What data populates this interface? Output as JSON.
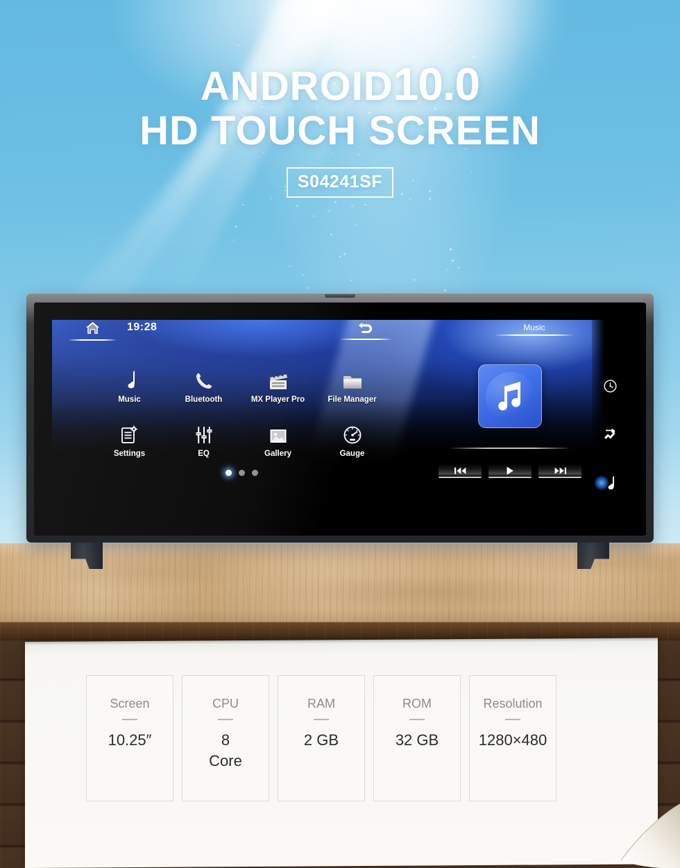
{
  "hero": {
    "line1_main": "ANDROID",
    "line1_version": "10.0",
    "line2": "HD TOUCH SCREEN",
    "model_badge": "S04241SF"
  },
  "colors": {
    "sky": "#63b9e2",
    "accent_blue": "#3f6fe8",
    "panel_bg": "#faf9f6",
    "wood_light": "#d9bb8e",
    "wood_dark": "#3d2a1b"
  },
  "device_screen": {
    "status_bar": {
      "home_icon": "home-icon",
      "clock": "19:28",
      "back_icon": "back-arrow-icon",
      "music_tab_label": "Music"
    },
    "apps": [
      {
        "label": "Music",
        "icon": "music-note-icon"
      },
      {
        "label": "Bluetooth",
        "icon": "phone-handset-icon"
      },
      {
        "label": "MX Player Pro",
        "icon": "clapperboard-icon"
      },
      {
        "label": "File Manager",
        "icon": "folder-icon"
      },
      {
        "label": "Settings",
        "icon": "settings-list-gear-icon"
      },
      {
        "label": "EQ",
        "icon": "equalizer-sliders-icon"
      },
      {
        "label": "Gallery",
        "icon": "photo-image-icon"
      },
      {
        "label": "Gauge",
        "icon": "speedometer-icon"
      }
    ],
    "page_dots": {
      "total": 3,
      "active_index": 0
    },
    "music_widget": {
      "title": "Music",
      "album_art_icon": "music-note-icon",
      "controls": [
        {
          "name": "previous",
          "icon": "skip-back-icon"
        },
        {
          "name": "play",
          "icon": "play-icon"
        },
        {
          "name": "next",
          "icon": "skip-forward-icon"
        }
      ]
    },
    "sidebar_icons": [
      {
        "name": "clock-icon",
        "active": false
      },
      {
        "name": "shortcut-runner-icon",
        "active": false
      },
      {
        "name": "music-note-icon",
        "active": true
      }
    ]
  },
  "specs": [
    {
      "key": "Screen",
      "value": "10.25″"
    },
    {
      "key": "CPU",
      "value": "8\nCore"
    },
    {
      "key": "RAM",
      "value": "2 GB"
    },
    {
      "key": "ROM",
      "value": "32 GB"
    },
    {
      "key": "Resolution",
      "value": "1280×480"
    }
  ]
}
